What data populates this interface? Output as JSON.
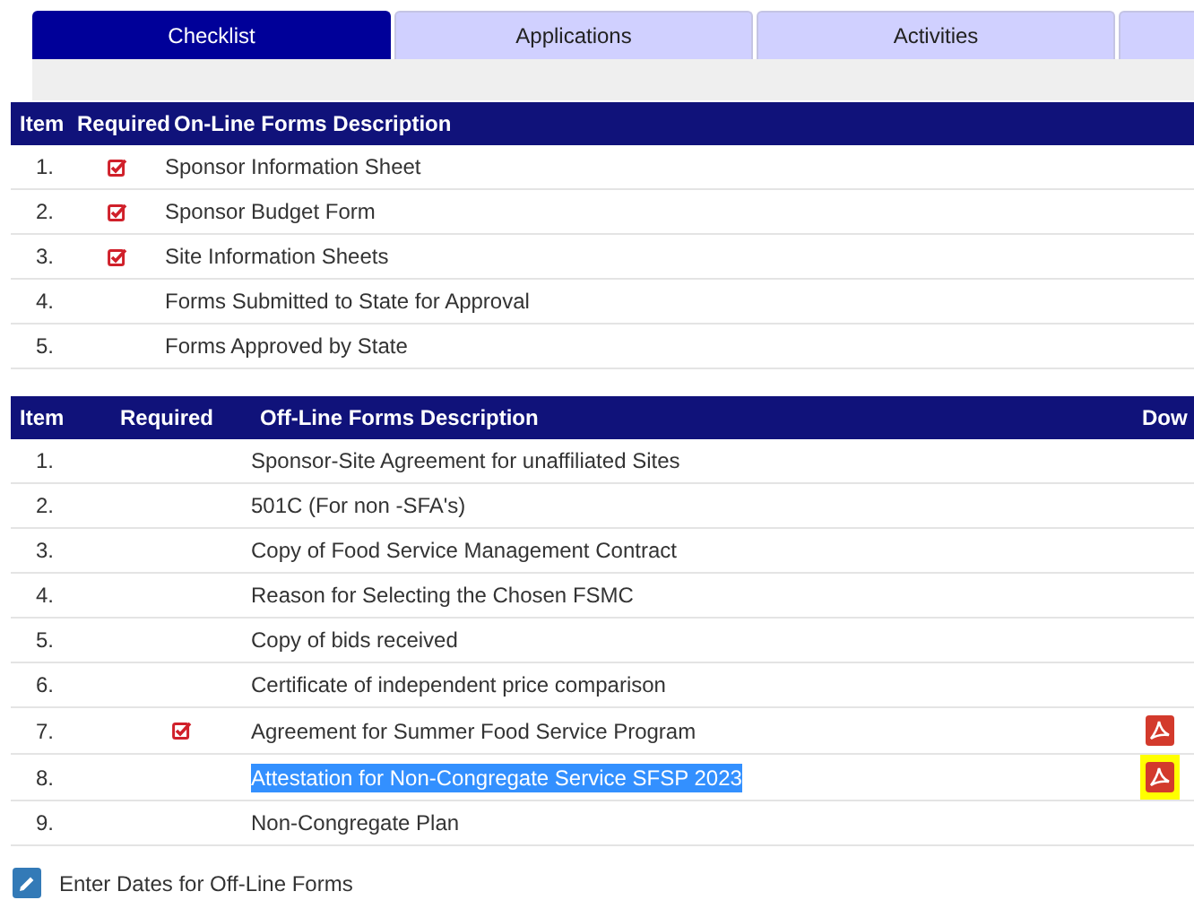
{
  "tabs": [
    {
      "label": "Checklist",
      "selected": true
    },
    {
      "label": "Applications",
      "selected": false
    },
    {
      "label": "Activities",
      "selected": false
    },
    {
      "selected": false
    }
  ],
  "online_table": {
    "columns": [
      "Item",
      "Required",
      "On-Line Forms Description"
    ],
    "rows": [
      {
        "item": "1.",
        "required": true,
        "description": "Sponsor Information Sheet"
      },
      {
        "item": "2.",
        "required": true,
        "description": "Sponsor Budget Form"
      },
      {
        "item": "3.",
        "required": true,
        "description": "Site Information Sheets"
      },
      {
        "item": "4.",
        "required": false,
        "description": "Forms Submitted to State for Approval"
      },
      {
        "item": "5.",
        "required": false,
        "description": "Forms Approved by State"
      }
    ]
  },
  "offline_table": {
    "columns": [
      "Item",
      "Required",
      "Off-Line Forms Description",
      "Dow"
    ],
    "rows": [
      {
        "item": "1.",
        "required": false,
        "description": "Sponsor-Site Agreement for unaffiliated Sites",
        "download": false,
        "selected": false
      },
      {
        "item": "2.",
        "required": false,
        "description": "501C (For non -SFA's)",
        "download": false,
        "selected": false
      },
      {
        "item": "3.",
        "required": false,
        "description": "Copy of Food Service Management Contract",
        "download": false,
        "selected": false
      },
      {
        "item": "4.",
        "required": false,
        "description": "Reason for Selecting the Chosen FSMC",
        "download": false,
        "selected": false
      },
      {
        "item": "5.",
        "required": false,
        "description": "Copy of bids received",
        "download": false,
        "selected": false
      },
      {
        "item": "6.",
        "required": false,
        "description": "Certificate of independent price comparison",
        "download": false,
        "selected": false
      },
      {
        "item": "7.",
        "required": true,
        "description": "Agreement for Summer Food Service Program",
        "download": true,
        "selected": false
      },
      {
        "item": "8.",
        "required": false,
        "description": "Attestation for Non-Congregate Service SFSP 2023",
        "download": true,
        "selected": true
      },
      {
        "item": "9.",
        "required": false,
        "description": "Non-Congregate Plan",
        "download": false,
        "selected": false
      }
    ]
  },
  "footer_action": {
    "label": "Enter Dates for Off-Line Forms"
  }
}
